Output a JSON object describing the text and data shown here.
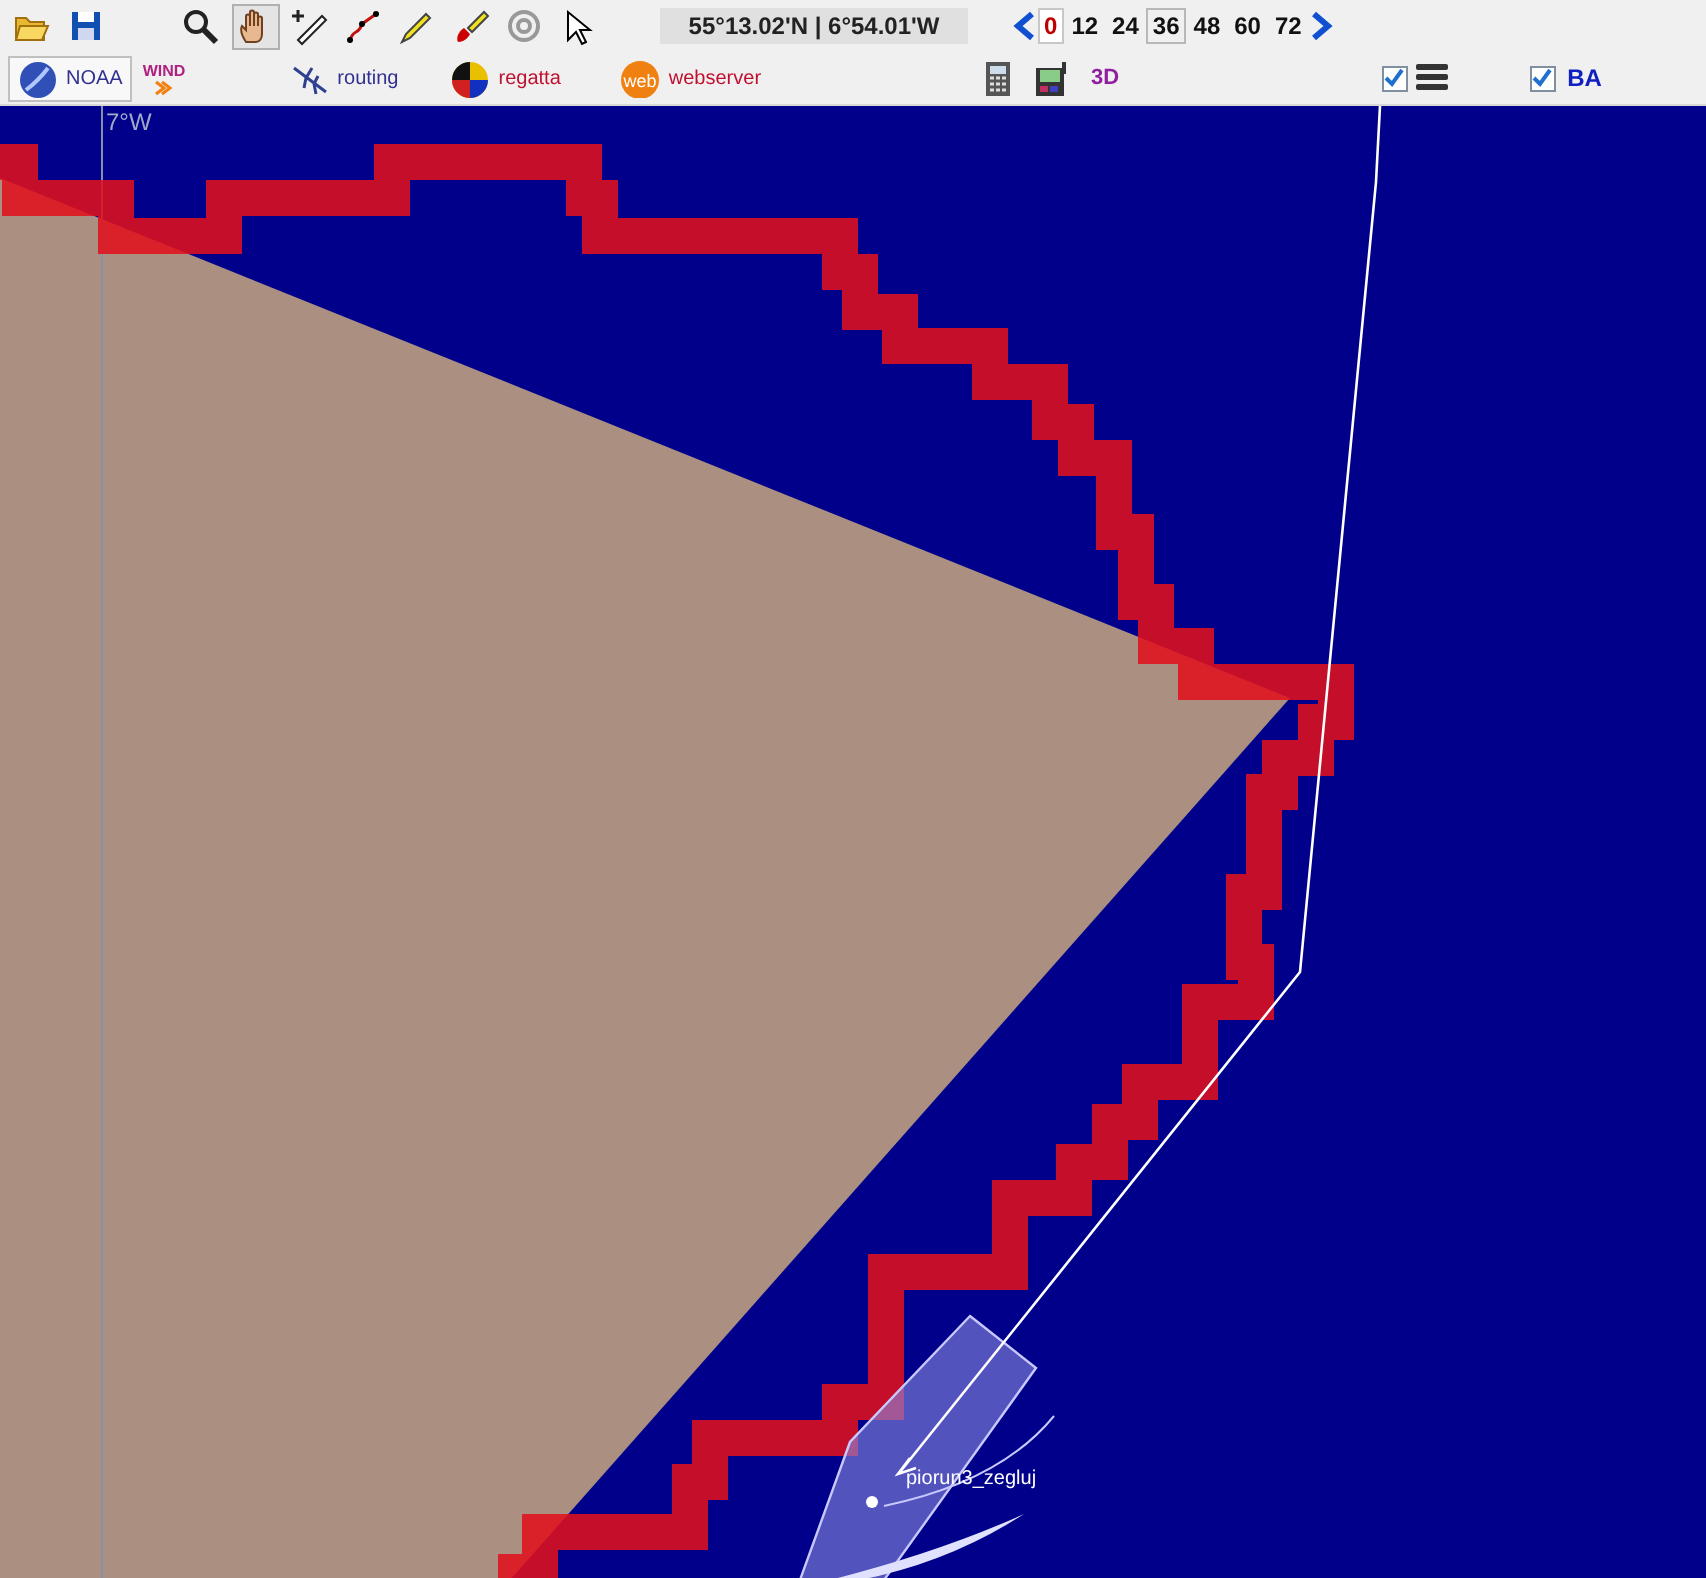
{
  "toolbar": {
    "tools": [
      {
        "kind": "open"
      },
      {
        "kind": "save"
      },
      {
        "kind": "zoom"
      },
      {
        "kind": "pan",
        "selected": true
      },
      {
        "kind": "measure",
        "selected": false
      },
      {
        "kind": "route",
        "selected": false
      },
      {
        "kind": "pencil",
        "selected": false
      },
      {
        "kind": "paint",
        "selected": false
      },
      {
        "kind": "target",
        "selected": false
      },
      {
        "kind": "pointer",
        "selected": false
      }
    ],
    "position": "55°13.02'N |  6°54.01'W",
    "hours": [
      {
        "label": "0",
        "selected": true,
        "highlighted": false
      },
      {
        "label": "12",
        "selected": false,
        "highlighted": false
      },
      {
        "label": "24",
        "selected": false,
        "highlighted": false
      },
      {
        "label": "36",
        "selected": false,
        "highlighted": true
      },
      {
        "label": "48",
        "selected": false,
        "highlighted": false
      },
      {
        "label": "60",
        "selected": false,
        "highlighted": false
      },
      {
        "label": "72",
        "selected": false,
        "highlighted": false
      }
    ]
  },
  "modules": [
    {
      "kind": "noaa",
      "label": "NOAA",
      "selected": true
    },
    {
      "kind": "wind",
      "label": "WIND",
      "selected": false
    },
    {
      "kind": "routing",
      "label": "routing",
      "selected": false
    },
    {
      "kind": "regatta",
      "label": "regatta",
      "selected": false
    },
    {
      "kind": "webserver",
      "label": "webserver",
      "icon_text": "web",
      "selected": false
    }
  ],
  "extras": [
    {
      "kind": "calculator"
    },
    {
      "kind": "gps"
    },
    {
      "kind": "text",
      "label": "3D"
    }
  ],
  "toggles": [
    {
      "kind": "layers",
      "checked": true
    },
    {
      "kind": "text",
      "label": "BA",
      "checked": true
    }
  ],
  "map": {
    "grid_label": "7°W",
    "boat": {
      "name": "piorun3_zegluj"
    }
  }
}
